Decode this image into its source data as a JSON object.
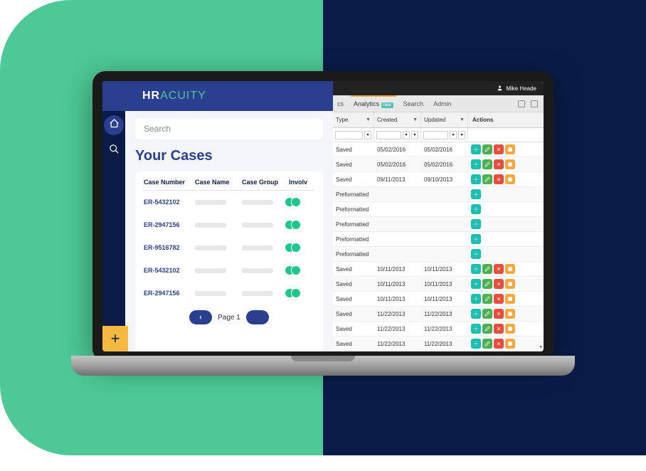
{
  "brand": {
    "left": "HR",
    "right": "ACUITY"
  },
  "search": {
    "placeholder": "Search"
  },
  "cases_title": "Your Cases",
  "case_columns": {
    "number": "Case Number",
    "name": "Case Name",
    "group": "Case Group",
    "involved": "Involv"
  },
  "cases": [
    {
      "number": "ER-5432102"
    },
    {
      "number": "ER-2947156"
    },
    {
      "number": "ER-9516782"
    },
    {
      "number": "ER-5432102"
    },
    {
      "number": "ER-2947156"
    }
  ],
  "pager": {
    "label": "Page 1"
  },
  "user": {
    "name": "Mike Heade"
  },
  "tabs": {
    "t1": "cs",
    "analytics": "Analytics",
    "new_badge": "new",
    "search": "Search",
    "admin": "Admin"
  },
  "grid": {
    "headers": {
      "type": "Type",
      "created": "Created",
      "updated": "Updated",
      "actions": "Actions"
    },
    "rows": [
      {
        "type": "Saved",
        "created": "05/02/2016",
        "updated": "05/02/2016",
        "btns": 4
      },
      {
        "type": "Saved",
        "created": "05/02/2016",
        "updated": "05/02/2016",
        "btns": 4
      },
      {
        "type": "Saved",
        "created": "09/11/2013",
        "updated": "09/10/2013",
        "btns": 4
      },
      {
        "type": "Preformatted",
        "created": "",
        "updated": "",
        "btns": 1
      },
      {
        "type": "Preformatted",
        "created": "",
        "updated": "",
        "btns": 1
      },
      {
        "type": "Preformatted",
        "created": "",
        "updated": "",
        "btns": 1
      },
      {
        "type": "Preformatted",
        "created": "",
        "updated": "",
        "btns": 1
      },
      {
        "type": "Preformatted",
        "created": "",
        "updated": "",
        "btns": 1
      },
      {
        "type": "Saved",
        "created": "10/11/2013",
        "updated": "10/11/2013",
        "btns": 4
      },
      {
        "type": "Saved",
        "created": "10/11/2013",
        "updated": "10/11/2013",
        "btns": 4
      },
      {
        "type": "Saved",
        "created": "10/11/2013",
        "updated": "10/11/2013",
        "btns": 4
      },
      {
        "type": "Saved",
        "created": "11/22/2013",
        "updated": "11/22/2013",
        "btns": 4
      },
      {
        "type": "Saved",
        "created": "11/22/2013",
        "updated": "11/22/2013",
        "btns": 4
      },
      {
        "type": "Saved",
        "created": "11/22/2013",
        "updated": "11/22/2013",
        "btns": 4
      }
    ]
  }
}
